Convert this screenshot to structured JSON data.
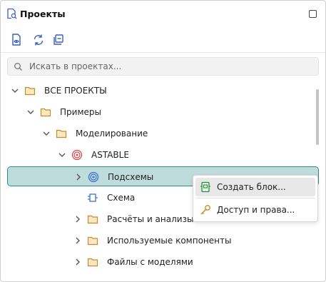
{
  "header": {
    "title": "Проекты",
    "icon": "project-search-icon"
  },
  "toolbar": {
    "buttons": [
      "file-eye-icon",
      "refresh-icon",
      "collapse-all-icon"
    ]
  },
  "search": {
    "placeholder": "Искать в проектах...",
    "value": ""
  },
  "tree": {
    "items": [
      {
        "label": "ВСЕ ПРОЕКТЫ",
        "icon": "folder-icon",
        "expanded": true
      },
      {
        "label": "Примеры",
        "icon": "folder-icon",
        "expanded": true
      },
      {
        "label": "Моделирование",
        "icon": "folder-icon",
        "expanded": true
      },
      {
        "label": "ASTABLE",
        "icon": "spiral-red-icon",
        "expanded": true
      },
      {
        "label": "Подсхемы",
        "icon": "spiral-blue-icon",
        "expanded": false,
        "selected": true
      },
      {
        "label": "Схема",
        "icon": "schema-icon"
      },
      {
        "label": "Расчёты и анализы",
        "icon": "folder-icon",
        "expanded": false
      },
      {
        "label": "Используемые компоненты",
        "icon": "folder-icon",
        "expanded": false
      },
      {
        "label": "Файлы с моделями",
        "icon": "folder-icon",
        "expanded": false
      }
    ]
  },
  "context_menu": {
    "items": [
      {
        "label": "Создать блок...",
        "icon": "block-green-icon"
      },
      {
        "label": "Доступ и права...",
        "icon": "key-icon"
      }
    ]
  },
  "colors": {
    "selection_bg": "#bfdcdc",
    "selection_border": "#2f8a8a",
    "folder": "#c98a2b",
    "red_spiral": "#d84a4a",
    "blue_spiral": "#3b6fd0"
  }
}
